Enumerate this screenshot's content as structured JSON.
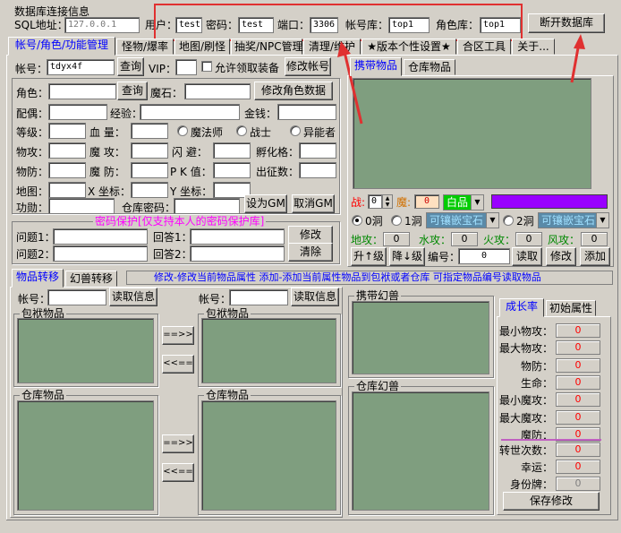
{
  "window": {
    "title_partial": "数据库连接信息"
  },
  "conn": {
    "sql_label": "SQL地址：",
    "sql_value": "127.0.0.1",
    "user_label": "用户：",
    "user_value": "test",
    "pwd_label": "密码：",
    "pwd_value": "test",
    "port_label": "端口：",
    "port_value": "3306",
    "acct_db_label": "帐号库：",
    "acct_db_value": "top1",
    "role_db_label": "角色库：",
    "role_db_value": "top1",
    "disconnect_label": "断开数据库"
  },
  "tabs": [
    "帐号/角色/功能管理",
    "怪物/爆率",
    "地图/刷怪",
    "抽奖/NPC管理",
    "清理/维护",
    "★版本个性设置★",
    "合区工具",
    "关于..."
  ],
  "account": {
    "acct_label": "帐号：",
    "acct_value": "tdyx4f",
    "query_label": "查询",
    "vip_label": "VIP：",
    "allow_label": "允许领取装备",
    "modify_acct_label": "修改帐号"
  },
  "role": {
    "role_label": "角色：",
    "query_label": "查询",
    "magic_label": "魔石：",
    "modify_role_label": "修改角色数据",
    "mate_label": "配偶：",
    "exp_label": "经验：",
    "money_label": "金钱：",
    "level_label": "等级：",
    "hp_label": "血  量：",
    "mage_label": "魔法师",
    "warrior_label": "战士",
    "esper_label": "异能者",
    "atk_label": "物攻：",
    "matk_label": "魔  攻：",
    "dodge_label": "闪  避：",
    "hatch_label": "孵化格：",
    "def_label": "物防：",
    "mdef_label": "魔  防：",
    "pk_label": "P K 值：",
    "war_label": "出征数：",
    "map_label": "地图：",
    "x_label": "X 坐标：",
    "y_label": "Y 坐标：",
    "merit_label": "功勋：",
    "bank_pwd_label": "仓库密码：",
    "set_gm_label": "设为GM",
    "cancel_gm_label": "取消GM"
  },
  "pwdprot": {
    "title": "密码保护[仅支持本人的密码保护库]",
    "q1": "问题1：",
    "a1": "回答1：",
    "q2": "问题2：",
    "a2": "回答2：",
    "modify": "修改",
    "clear": "清除"
  },
  "right_tabs": [
    "携带物品",
    "仓库物品"
  ],
  "equip": {
    "zhan": "战:",
    "zhan_val": "0",
    "mo": "魔:",
    "mo_val": "0",
    "quality": "白品",
    "hole0": "0洞",
    "hole1": "1洞",
    "hole2": "2洞",
    "gem1": "可镶嵌宝石",
    "gem2": "可镶嵌宝石",
    "earth": "地攻：",
    "earth_val": "0",
    "water": "水攻：",
    "water_val": "0",
    "fire": "火攻：",
    "fire_val": "0",
    "wind": "风攻：",
    "wind_val": "0",
    "up": "升↑级",
    "down": "降↓级",
    "code": "编号：",
    "code_val": "0",
    "read": "读取",
    "modify": "修改",
    "add": "添加"
  },
  "lower_tabs": [
    "物品转移",
    "幻兽转移"
  ],
  "hint": "修改-修改当前物品属性 添加-添加当前属性物品到包袱或者仓库 可指定物品编号读取物品",
  "transfer": {
    "acct_label": "帐号：",
    "read_label": "读取信息",
    "bag": "包袱物品",
    "bank": "仓库物品",
    "to_right": "==>>",
    "to_left": "<<=="
  },
  "pets": {
    "carry": "携带幻兽",
    "bank": "仓库幻兽"
  },
  "growth": {
    "tabs": [
      "成长率",
      "初始属性"
    ],
    "rows": [
      {
        "label": "最小物攻：",
        "value": "0"
      },
      {
        "label": "最大物攻：",
        "value": "0"
      },
      {
        "label": "物防：",
        "value": "0"
      },
      {
        "label": "生命：",
        "value": "0"
      },
      {
        "label": "最小魔攻：",
        "value": "0"
      },
      {
        "label": "最大魔攻：",
        "value": "0"
      },
      {
        "label": "魔防：",
        "value": "0"
      }
    ],
    "rows2": [
      {
        "label": "转世次数：",
        "value": "0"
      },
      {
        "label": "幸运：",
        "value": "0"
      },
      {
        "label": "身份牌：",
        "value": "0"
      }
    ],
    "save": "保存修改"
  },
  "colors": {
    "accent_red": "#ff0000",
    "link_blue": "#0000ff",
    "pink": "#ff00ff",
    "green_panel": "#7f9e7f",
    "violet_bar": "#9900ff"
  }
}
